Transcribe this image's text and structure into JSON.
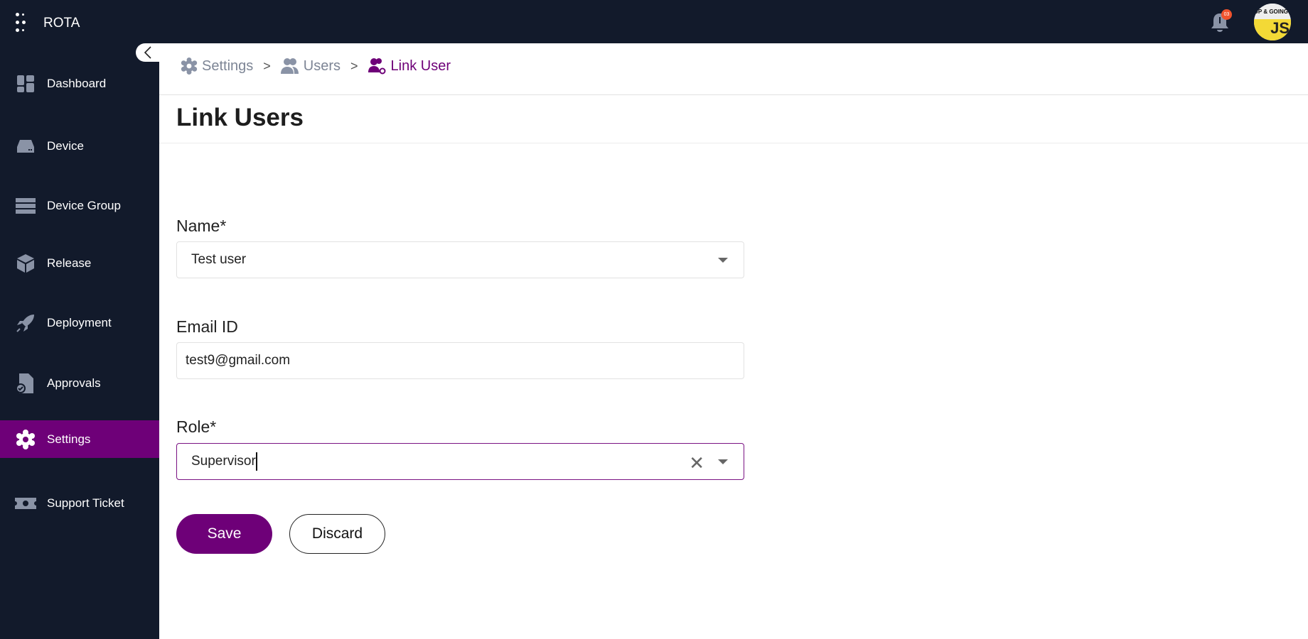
{
  "app": {
    "title": "ROTA",
    "notification_count": "03",
    "avatar_text_top": "UP & GOING",
    "avatar_text_bottom": "JS"
  },
  "sidebar": {
    "items": [
      {
        "label": "Dashboard",
        "icon": "dashboard-icon"
      },
      {
        "label": "Device",
        "icon": "device-icon"
      },
      {
        "label": "Device Group",
        "icon": "device-group-icon"
      },
      {
        "label": "Release",
        "icon": "package-icon"
      },
      {
        "label": "Deployment",
        "icon": "rocket-icon"
      },
      {
        "label": "Approvals",
        "icon": "approvals-icon"
      },
      {
        "label": "Settings",
        "icon": "gear-icon",
        "active": true
      },
      {
        "label": "Support Ticket",
        "icon": "ticket-icon"
      }
    ]
  },
  "breadcrumb": {
    "items": [
      "Settings",
      "Users",
      "Link User"
    ]
  },
  "page": {
    "title": "Link Users"
  },
  "form": {
    "name": {
      "label": "Name*",
      "value": "Test user"
    },
    "email": {
      "label": "Email ID",
      "value": "test9@gmail.com"
    },
    "role": {
      "label": "Role*",
      "value": "Supervisor"
    },
    "save_label": "Save",
    "discard_label": "Discard"
  },
  "colors": {
    "accent": "#6e0078",
    "sidebar": "#121a2b",
    "badge": "#f0532d"
  }
}
